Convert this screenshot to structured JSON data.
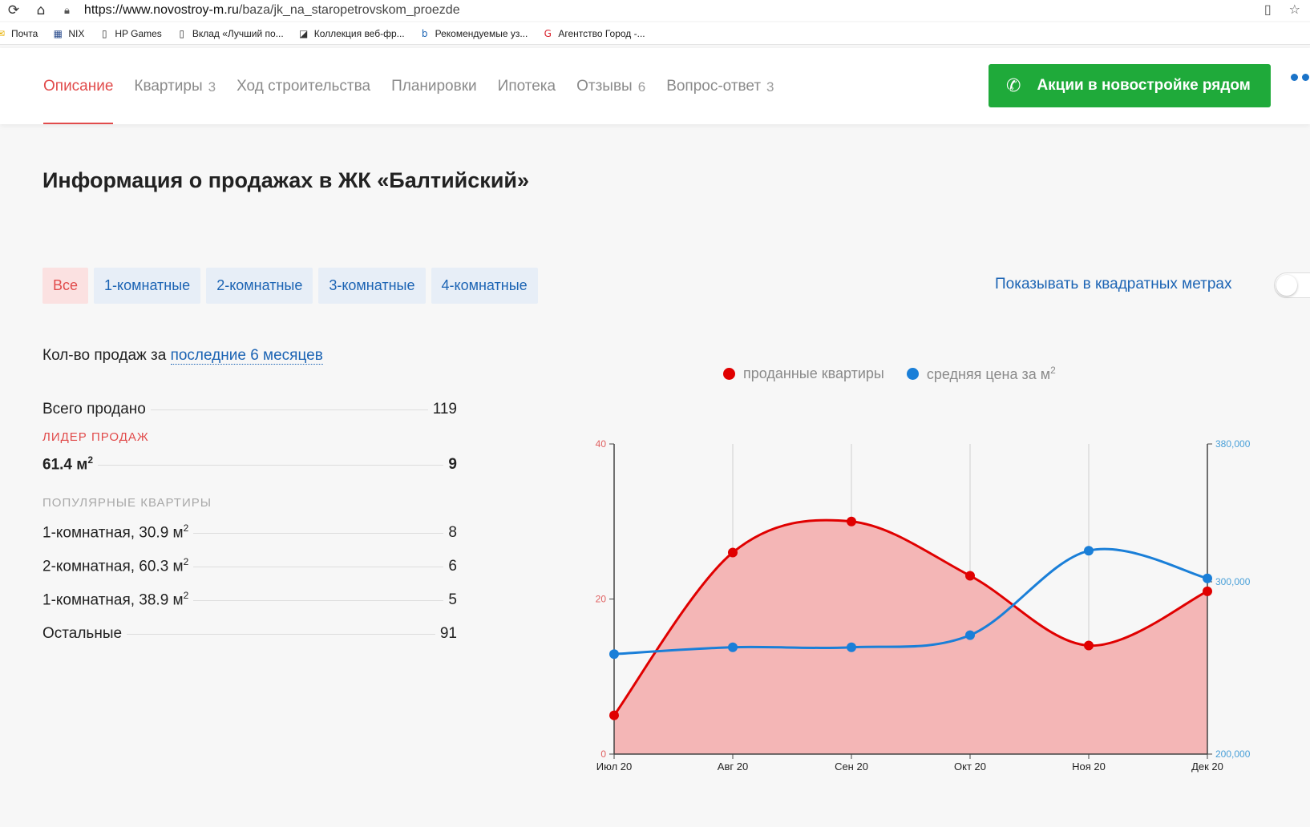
{
  "browser": {
    "url_host": "https://www.novostroy-m.ru",
    "url_path": "/baza/jk_na_staropetrovskom_proezde",
    "bookmarks": [
      {
        "label": "Почта",
        "icon": "mail-icon",
        "color": "#e8b100"
      },
      {
        "label": "NIX",
        "icon": "nix-icon",
        "color": "#2a4c8c"
      },
      {
        "label": "HP Games",
        "icon": "page-icon",
        "color": "#333333"
      },
      {
        "label": "Вклад «Лучший по...",
        "icon": "page-icon",
        "color": "#333333"
      },
      {
        "label": "Коллекция веб-фр...",
        "icon": "collection-icon",
        "color": "#333333"
      },
      {
        "label": "Рекомендуемые уз...",
        "icon": "bing-icon",
        "color": "#1c64b4"
      },
      {
        "label": "Агентство Город -...",
        "icon": "g-icon",
        "color": "#d9232e"
      }
    ]
  },
  "nav": {
    "tabs": [
      {
        "label": "Описание",
        "count": "",
        "active": true
      },
      {
        "label": "Квартиры",
        "count": "3"
      },
      {
        "label": "Ход строительства",
        "count": ""
      },
      {
        "label": "Планировки",
        "count": ""
      },
      {
        "label": "Ипотека",
        "count": ""
      },
      {
        "label": "Отзывы",
        "count": "6"
      },
      {
        "label": "Вопрос-ответ",
        "count": "3"
      }
    ],
    "promo_button": "Акции в новостройке рядом",
    "promo_color": "#1faa3a"
  },
  "title": "Информация о продажах в ЖК «Балтийский»",
  "filters": [
    "Все",
    "1-комнатные",
    "2-комнатные",
    "3-комнатные",
    "4-комнатные"
  ],
  "sqm_toggle_label": "Показывать в квадратных метрах",
  "sales": {
    "period_prefix": "Кол-во продаж за",
    "period_link": "последние 6 месяцев",
    "total_label": "Всего продано",
    "total_value": "119",
    "leader_caption": "ЛИДЕР ПРОДАЖ",
    "leader_label": "61.4 м",
    "leader_value": "9",
    "popular_caption": "ПОПУЛЯРНЫЕ КВАРТИРЫ",
    "popular": [
      {
        "label": "1-комнатная, 30.9 м",
        "value": "8"
      },
      {
        "label": "2-комнатная, 60.3 м",
        "value": "6"
      },
      {
        "label": "1-комнатная, 38.9 м",
        "value": "5"
      }
    ],
    "other_label": "Остальные",
    "other_value": "91"
  },
  "chart_data": {
    "type": "line",
    "categories": [
      "Июл 20",
      "Авг 20",
      "Сен 20",
      "Окт 20",
      "Ноя 20",
      "Дек 20"
    ],
    "series": [
      {
        "name": "проданные квартиры",
        "axis": "left",
        "color": "#e00000",
        "fill": "#f4b6b6",
        "values": [
          5,
          26,
          30,
          23,
          14,
          21
        ]
      },
      {
        "name": "средняя цена за м",
        "axis": "right",
        "color": "#1a7fd8",
        "values": [
          258000,
          262000,
          262000,
          269000,
          318000,
          302000
        ]
      }
    ],
    "y_left": {
      "min": 0,
      "max": 40,
      "ticks": [
        "0",
        "20",
        "40"
      ],
      "color": "#e06060"
    },
    "y_right": {
      "min": 200000,
      "max": 380000,
      "ticks": [
        "200,000",
        "300,000",
        "380,000"
      ],
      "tick_values": [
        200000,
        300000,
        380000
      ],
      "color": "#4aa0d8"
    },
    "grid": "vertical",
    "legend": "top-center"
  }
}
